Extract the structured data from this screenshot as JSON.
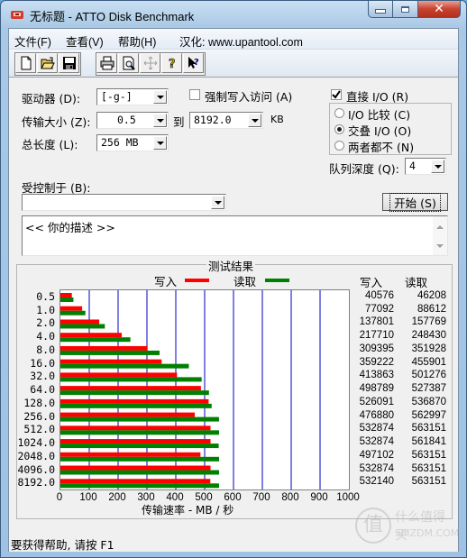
{
  "window": {
    "title": "无标题 - ATTO Disk Benchmark",
    "minimize_label": "—",
    "maximize_label": "□",
    "close_label": "✕"
  },
  "menu": {
    "items": [
      "文件(F)",
      "查看(V)",
      "帮助(H)"
    ],
    "credit": "汉化: www.upantool.com"
  },
  "toolbar": {
    "buttons": [
      "new-icon",
      "open-icon",
      "save-icon",
      "print-icon",
      "print-preview-icon",
      "move-icon",
      "help-icon",
      "context-help-icon"
    ]
  },
  "settings": {
    "drive_label": "驱动器 (D):",
    "drive_value": "[-g-]",
    "force_write_label": "强制写入访问 (A)",
    "force_write_checked": false,
    "transfer_size_label": "传输大小 (Z):",
    "transfer_from": "0.5",
    "to_label": "到",
    "transfer_to": "8192.0",
    "kb_label": "KB",
    "total_length_label": "总长度 (L):",
    "total_length_value": "256 MB",
    "direct_io_label": "直接 I/O (R)",
    "direct_io_checked": true,
    "io_compare_label": "I/O 比较 (C)",
    "overlapped_io_label": "交叠 I/O (O)",
    "neither_label": "两者都不 (N)",
    "selected_mode": "交叠 I/O (O)",
    "queue_depth_label": "队列深度 (Q):",
    "queue_depth_value": "4",
    "controlled_by_label": "受控制于 (B):",
    "controlled_by_value": "",
    "start_button": "开始 (S)",
    "description": "<<   你的描述    >>"
  },
  "results": {
    "title": "测试结果",
    "write_legend": "写入",
    "read_legend": "读取",
    "write_header": "写入",
    "read_header": "读取",
    "xlabel": "传输速率 - MB / 秒",
    "colors": {
      "write": "#ff0000",
      "read": "#008000",
      "grid": "#0000c0"
    }
  },
  "chart_data": {
    "type": "bar",
    "orientation": "horizontal",
    "title": "测试结果",
    "xlabel": "传输速率 - MB / 秒",
    "ylabel": "",
    "xlim": [
      0,
      1000
    ],
    "xticks": [
      "0",
      "100",
      "200",
      "300",
      "400",
      "500",
      "600",
      "700",
      "800",
      "900",
      "1000"
    ],
    "grid": true,
    "legend": "top-center",
    "categories": [
      "0.5",
      "1.0",
      "2.0",
      "4.0",
      "8.0",
      "16.0",
      "32.0",
      "64.0",
      "128.0",
      "256.0",
      "512.0",
      "1024.0",
      "2048.0",
      "4096.0",
      "8192.0"
    ],
    "series": [
      {
        "name": "写入",
        "color": "#ff0000",
        "values_kb": [
          40576,
          77092,
          137801,
          217710,
          309395,
          359222,
          413863,
          498789,
          526091,
          476880,
          532874,
          532874,
          497102,
          532874,
          532140
        ]
      },
      {
        "name": "读取",
        "color": "#008000",
        "values_kb": [
          46208,
          88612,
          157769,
          248430,
          351928,
          455901,
          501276,
          527387,
          536870,
          562997,
          563151,
          561841,
          563151,
          563151,
          563151
        ]
      }
    ]
  },
  "status": {
    "text": "要获得帮助, 请按 F1"
  },
  "watermark": {
    "glyph": "值",
    "line1": "什么值得买",
    "line2": "SMZDM.COM"
  }
}
